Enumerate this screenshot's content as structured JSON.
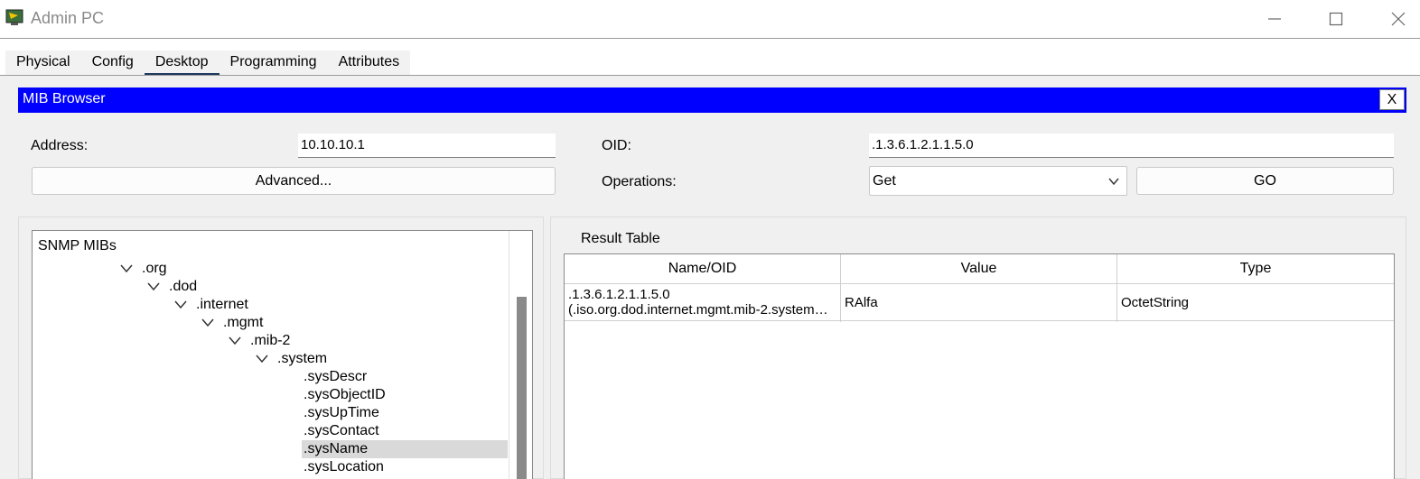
{
  "window": {
    "title": "Admin PC",
    "app_icon": "packet-tracer-pc-icon",
    "controls": [
      "minimize-icon",
      "maximize-icon",
      "close-icon"
    ]
  },
  "tabs": [
    {
      "label": "Physical"
    },
    {
      "label": "Config"
    },
    {
      "label": "Desktop",
      "active": true
    },
    {
      "label": "Programming"
    },
    {
      "label": "Attributes"
    }
  ],
  "mib_browser": {
    "title": "MIB Browser",
    "close_label": "X",
    "header_color": "#0000ff",
    "address_label": "Address:",
    "address_value": "10.10.10.1",
    "advanced_label": "Advanced...",
    "oid_label": "OID:",
    "oid_value": ".1.3.6.1.2.1.1.5.0",
    "operations_label": "Operations:",
    "operation_selected": "Get",
    "go_label": "GO"
  },
  "tree": {
    "root": "SNMP MIBs",
    "nodes": [
      {
        "label": ".org",
        "expanded": true
      },
      {
        "label": ".dod",
        "expanded": true
      },
      {
        "label": ".internet",
        "expanded": true
      },
      {
        "label": ".mgmt",
        "expanded": true
      },
      {
        "label": ".mib-2",
        "expanded": true
      },
      {
        "label": ".system",
        "expanded": true
      },
      {
        "label": ".sysDescr"
      },
      {
        "label": ".sysObjectID"
      },
      {
        "label": ".sysUpTime"
      },
      {
        "label": ".sysContact"
      },
      {
        "label": ".sysName",
        "selected": true
      },
      {
        "label": ".sysLocation"
      }
    ]
  },
  "result_table": {
    "title": "Result Table",
    "columns": [
      "Name/OID",
      "Value",
      "Type"
    ],
    "rows": [
      {
        "oid": ".1.3.6.1.2.1.1.5.0",
        "oid_name": "(.iso.org.dod.internet.mgmt.mib-2.system…",
        "value": "RAlfa",
        "type": "OctetString"
      }
    ]
  }
}
